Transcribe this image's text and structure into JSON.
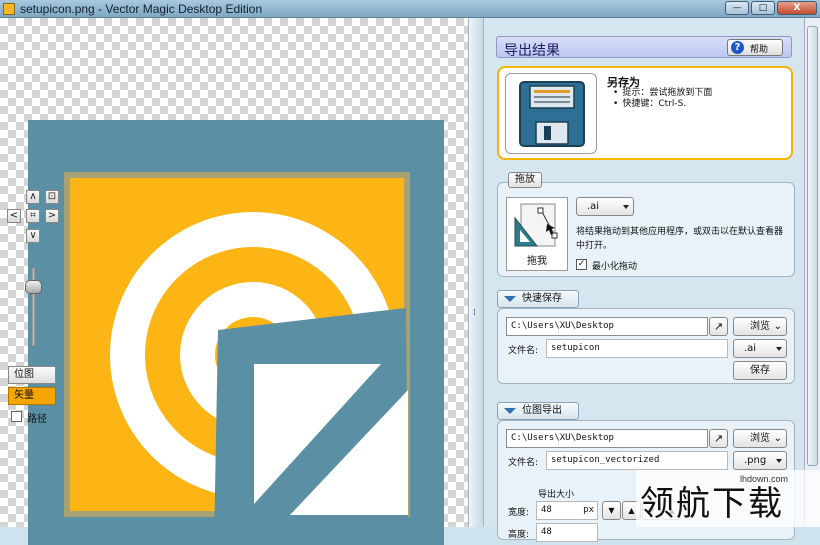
{
  "window": {
    "title": "setupicon.png - Vector Magic Desktop Edition",
    "buttons": {
      "minimize": "—",
      "maximize": "□",
      "close": "X"
    }
  },
  "canvas": {
    "nav": {
      "up": "∧",
      "down": "∨",
      "left": "<",
      "right": ">",
      "center": "⌗",
      "fit": "⊡"
    },
    "view_modes": [
      "位图",
      "矢量"
    ],
    "active_view": "矢量",
    "path_label": "路径",
    "path_checked": false,
    "colors": {
      "background": "#5b90a4",
      "yellow": "#fdb515",
      "white": "#ffffff"
    }
  },
  "panel": {
    "title": "导出结果",
    "help_label": "帮助",
    "save_as": {
      "title": "另存为",
      "tips": [
        "提示：尝试拖放到下面",
        "快捷键：Ctrl-S."
      ]
    },
    "drag": {
      "tab_label": "拖放",
      "icon_label": "拖我",
      "format": ".ai",
      "description": "将结果拖动到其他应用程序，或双击以在默认查看器中打开。",
      "minimize_label": "最小化拖动",
      "minimize_checked": true
    },
    "quick_save": {
      "tab_label": "快速保存",
      "path": "C:\\Users\\XU\\Desktop",
      "browse_label": "浏览",
      "filename_label": "文件名:",
      "filename": "setupicon",
      "format": ".ai",
      "save_label": "保存"
    },
    "bitmap_export": {
      "tab_label": "位图导出",
      "path": "C:\\Users\\XU\\Desktop",
      "browse_label": "浏览",
      "filename_label": "文件名:",
      "filename": "setupicon_vectorized",
      "format": ".png",
      "size_label": "导出大小",
      "width_label": "宽度:",
      "width_value": "48",
      "unit": "px",
      "height_label": "高度:",
      "height_value": "48"
    }
  },
  "watermark": {
    "site": "lhdown.com",
    "text": "领航下载"
  }
}
